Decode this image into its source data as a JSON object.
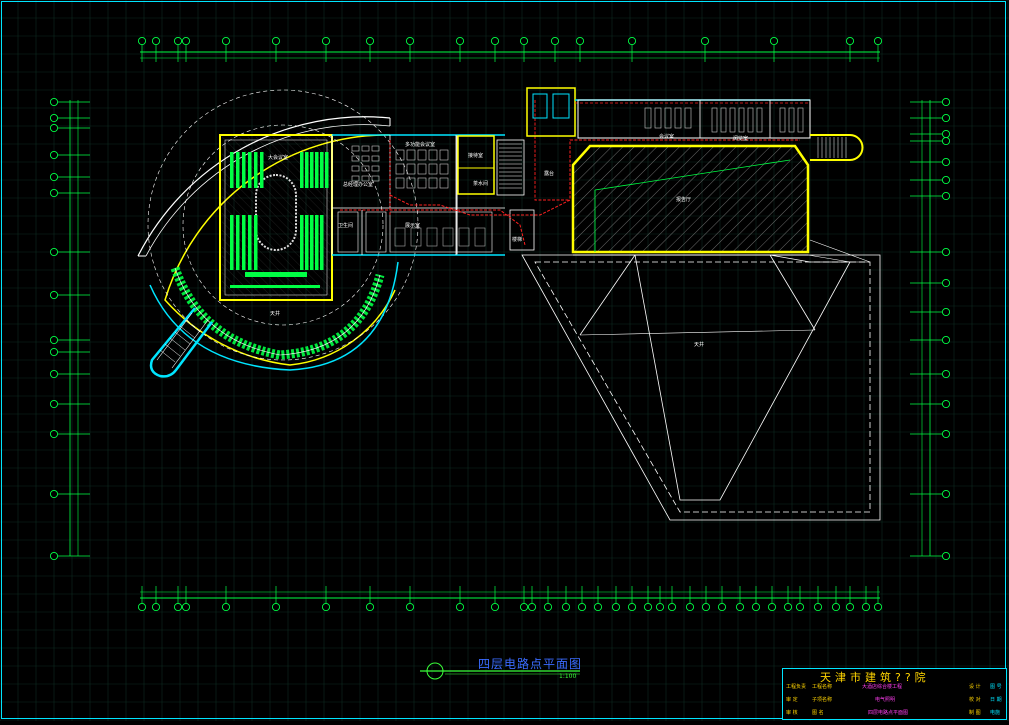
{
  "drawing": {
    "title": "四层电路点平面图",
    "scale": "1:100"
  },
  "colors": {
    "background": "#000000",
    "grid": "#0f2a22",
    "axis_line": "#00ff44",
    "wall": "#ffffff",
    "wall_major": "#ffff00",
    "cyan": "#00e5ff",
    "circuit": "#ff2020",
    "equipment": "#00ff44",
    "title": "#3a6bff"
  },
  "rooms": [
    {
      "id": "auditorium",
      "label": "大会议室"
    },
    {
      "id": "roof",
      "label": "天井"
    },
    {
      "id": "office_a",
      "label": "多功能会议室"
    },
    {
      "id": "office_b",
      "label": "总经理办公室"
    },
    {
      "id": "reception",
      "label": "接待室"
    },
    {
      "id": "lounge",
      "label": "展示室"
    },
    {
      "id": "toilet",
      "label": "卫生间"
    },
    {
      "id": "stair",
      "label": "楼梯"
    },
    {
      "id": "pantry",
      "label": "茶水间"
    },
    {
      "id": "court",
      "label": "露台"
    },
    {
      "id": "big_room",
      "label": "报告厅"
    },
    {
      "id": "roof_main",
      "label": "天井"
    },
    {
      "id": "meeting",
      "label": "会议室"
    },
    {
      "id": "cyan_room",
      "label": "阅览室"
    }
  ],
  "title_block": {
    "org": "天津市建筑??院",
    "rows": [
      {
        "a": "工程负责",
        "b": "工程名称",
        "c": "大酒店综合楼工程",
        "d": "设 计",
        "e": "图 号"
      },
      {
        "a": "审 定",
        "b": "子项名称",
        "c": "电气照明",
        "d": "校 对",
        "e": "日 期"
      },
      {
        "a": "审 核",
        "b": "图 名",
        "c": "四层电路点平面图",
        "d": "制 图",
        "e": "电施"
      }
    ]
  }
}
